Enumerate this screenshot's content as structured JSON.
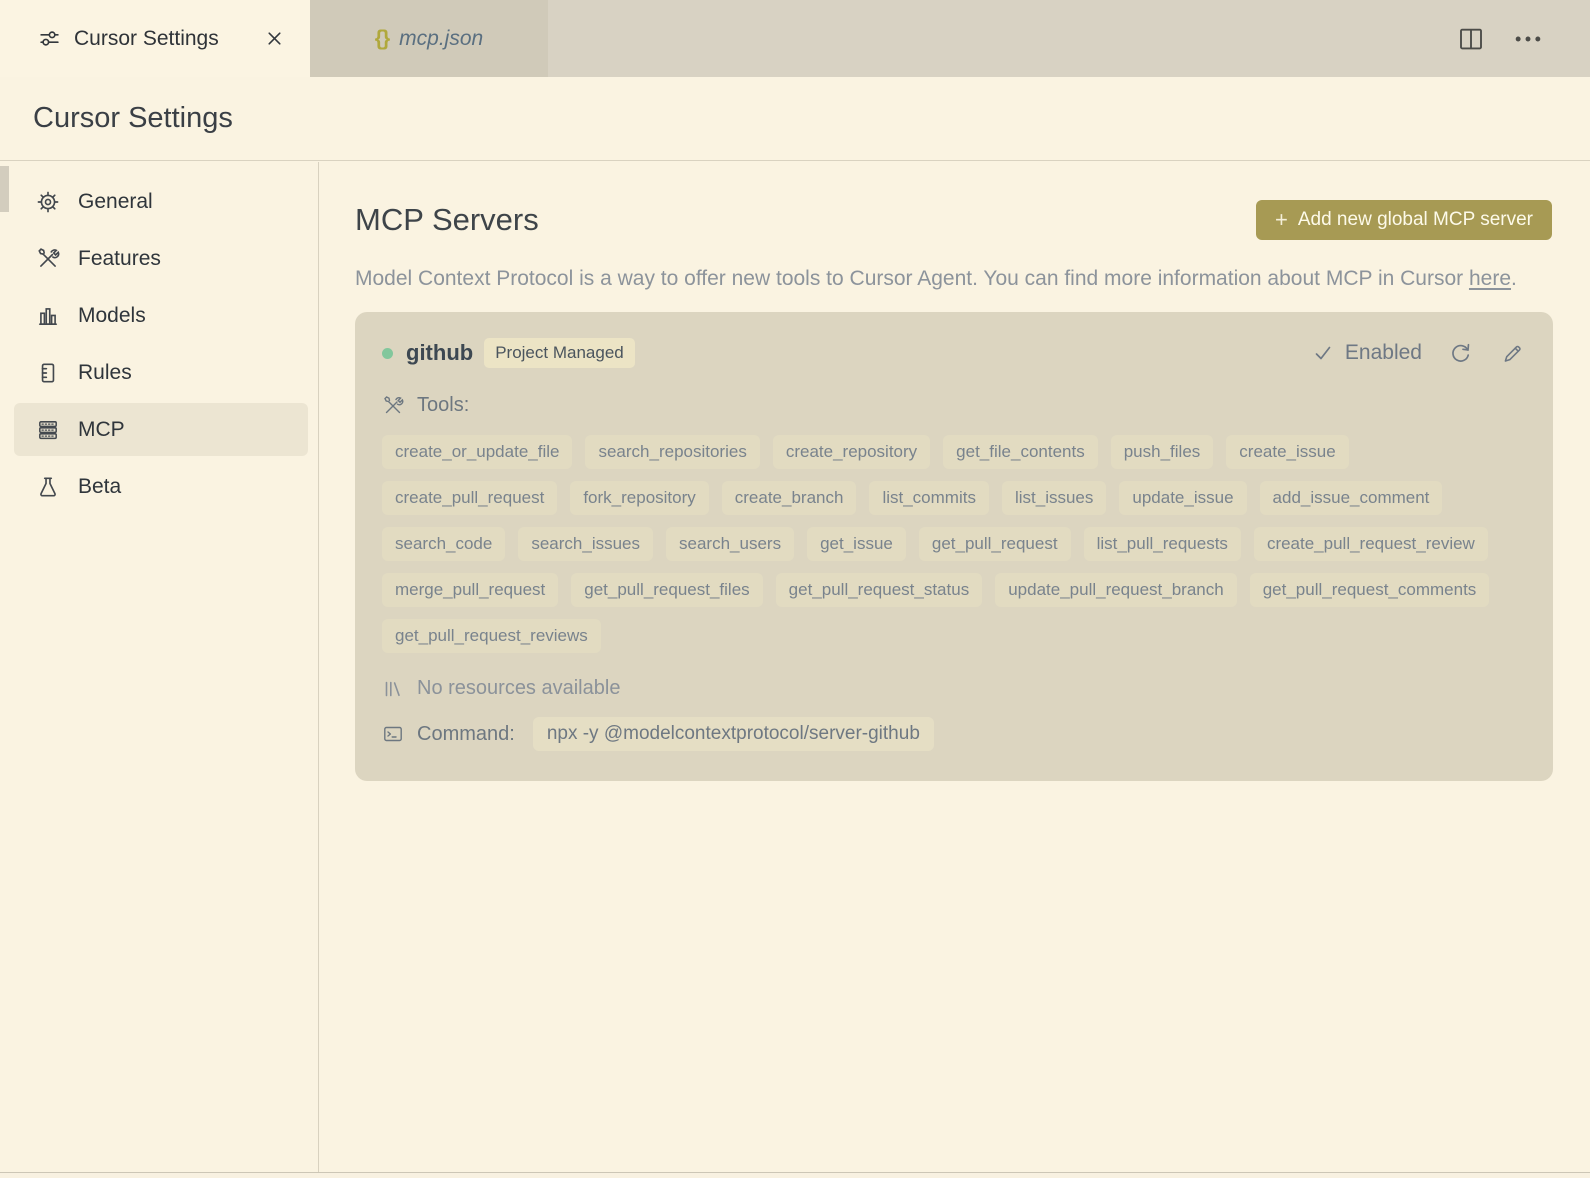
{
  "window": {
    "tabs": [
      {
        "label": "Cursor Settings",
        "icon": "sliders-icon",
        "active": true
      },
      {
        "label": "mcp.json",
        "icon": "braces-icon",
        "braces_glyph": "{}",
        "active": false
      }
    ]
  },
  "page": {
    "title": "Cursor Settings"
  },
  "sidebar": {
    "items": [
      {
        "label": "General",
        "icon": "gear-icon",
        "selected": false
      },
      {
        "label": "Features",
        "icon": "tools-icon",
        "selected": false
      },
      {
        "label": "Models",
        "icon": "bar-chart-icon",
        "selected": false
      },
      {
        "label": "Rules",
        "icon": "ruler-icon",
        "selected": false
      },
      {
        "label": "MCP",
        "icon": "server-stack-icon",
        "selected": true
      },
      {
        "label": "Beta",
        "icon": "flask-icon",
        "selected": false
      }
    ]
  },
  "main": {
    "title": "MCP Servers",
    "add_button": {
      "plus": "+",
      "label": "Add new global MCP server"
    },
    "description_before_link": "Model Context Protocol is a way to offer new tools to Cursor Agent. You can find more information about MCP in Cursor ",
    "description_link": "here",
    "description_after_link": ".",
    "server": {
      "name": "github",
      "badge": "Project Managed",
      "status_label": "Enabled",
      "tools_label": "Tools:",
      "tools": [
        "create_or_update_file",
        "search_repositories",
        "create_repository",
        "get_file_contents",
        "push_files",
        "create_issue",
        "create_pull_request",
        "fork_repository",
        "create_branch",
        "list_commits",
        "list_issues",
        "update_issue",
        "add_issue_comment",
        "search_code",
        "search_issues",
        "search_users",
        "get_issue",
        "get_pull_request",
        "list_pull_requests",
        "create_pull_request_review",
        "merge_pull_request",
        "get_pull_request_files",
        "get_pull_request_status",
        "update_pull_request_branch",
        "get_pull_request_comments",
        "get_pull_request_reviews"
      ],
      "resources_text": "No resources available",
      "command_label": "Command:",
      "command": "npx -y @modelcontextprotocol/server-github"
    }
  },
  "colors": {
    "background_cream": "#faf3e1",
    "tabbar_tan": "#d8d2c3",
    "inactive_tab_tan": "#d0cab9",
    "card_tan": "#dcd5c0",
    "tag_bg": "#e2dbc1",
    "badge_bg": "#ece4c5",
    "accent_olive_button": "#a79a54",
    "braces_olive": "#b0a83c",
    "status_dot_green": "#82c79c",
    "selected_sidebar_item": "#ece5d2",
    "muted_text": "#8c939b",
    "dark_text": "#2f3338"
  }
}
